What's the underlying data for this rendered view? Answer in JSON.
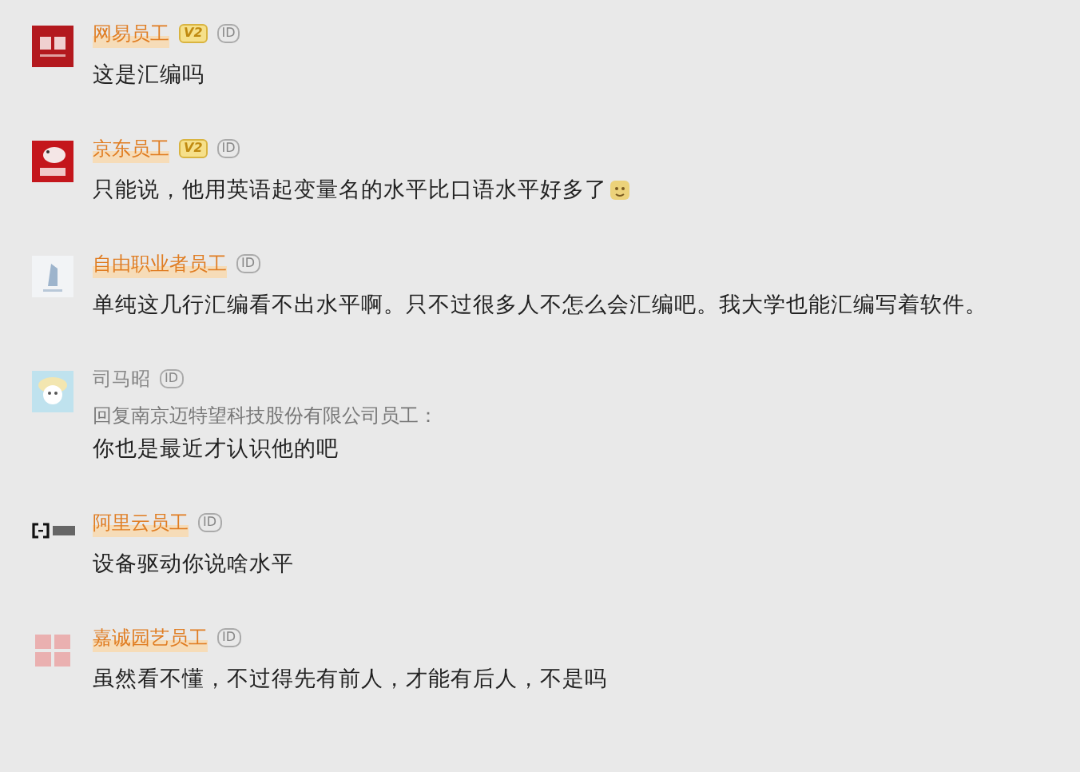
{
  "comments": [
    {
      "avatar": {
        "kind": "red-mark"
      },
      "name": "网易员工",
      "highlighted": true,
      "badges": [
        {
          "kind": "level",
          "text": "V2"
        },
        {
          "kind": "id",
          "text": "ID"
        }
      ],
      "text": "这是汇编吗"
    },
    {
      "avatar": {
        "kind": "red-bird"
      },
      "name": "京东员工",
      "highlighted": true,
      "badges": [
        {
          "kind": "level",
          "text": "V2"
        },
        {
          "kind": "id",
          "text": "ID"
        }
      ],
      "text": "只能说，他用英语起变量名的水平比口语水平好多了",
      "emoji": true
    },
    {
      "avatar": {
        "kind": "tower"
      },
      "name": "自由职业者员工",
      "highlighted": true,
      "badges": [
        {
          "kind": "id",
          "text": "ID"
        }
      ],
      "text": "单纯这几行汇编看不出水平啊。只不过很多人不怎么会汇编吧。我大学也能汇编写着软件。"
    },
    {
      "avatar": {
        "kind": "sheep"
      },
      "name": "司马昭",
      "highlighted": false,
      "badges": [
        {
          "kind": "id",
          "text": "ID"
        }
      ],
      "reply_to": "回复南京迈特望科技股份有限公司员工：",
      "text": "你也是最近才认识他的吧"
    },
    {
      "avatar": {
        "kind": "bracket"
      },
      "name": "阿里云员工",
      "highlighted": true,
      "badges": [
        {
          "kind": "id",
          "text": "ID"
        }
      ],
      "text": "设备驱动你说啥水平"
    },
    {
      "avatar": {
        "kind": "pink-blocks"
      },
      "name": "嘉诚园艺员工",
      "highlighted": true,
      "badges": [
        {
          "kind": "id",
          "text": "ID"
        }
      ],
      "text": "虽然看不懂，不过得先有前人，才能有后人，不是吗"
    }
  ]
}
